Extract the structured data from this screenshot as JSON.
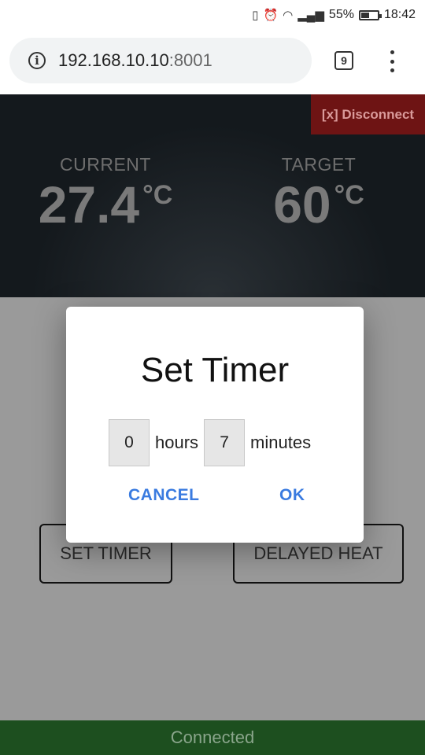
{
  "status_bar": {
    "icons": [
      "vibrate-icon",
      "alarm-icon",
      "wifi-icon",
      "signal-icon"
    ],
    "battery_percent": "55%",
    "battery_level": 0.55,
    "time": "18:42"
  },
  "browser": {
    "url_host": "192.168.10.10",
    "url_port": ":8001",
    "tab_count": "9"
  },
  "app": {
    "disconnect_label": "[x] Disconnect",
    "current": {
      "label": "CURRENT",
      "value": "27.4",
      "unit": "°C"
    },
    "target": {
      "label": "TARGET",
      "value": "60",
      "unit": "°C"
    },
    "buttons": {
      "set_timer": "SET TIMER",
      "delayed_heat": "DELAYED HEAT"
    },
    "footer_status": "Connected"
  },
  "dialog": {
    "title": "Set Timer",
    "hours_value": "0",
    "hours_label": "hours",
    "minutes_value": "7",
    "minutes_label": "minutes",
    "cancel_label": "CANCEL",
    "ok_label": "OK"
  },
  "colors": {
    "disconnect_bg": "#6e1414",
    "footer_bg": "#1d4f1f",
    "dialog_button": "#3a7be0"
  }
}
